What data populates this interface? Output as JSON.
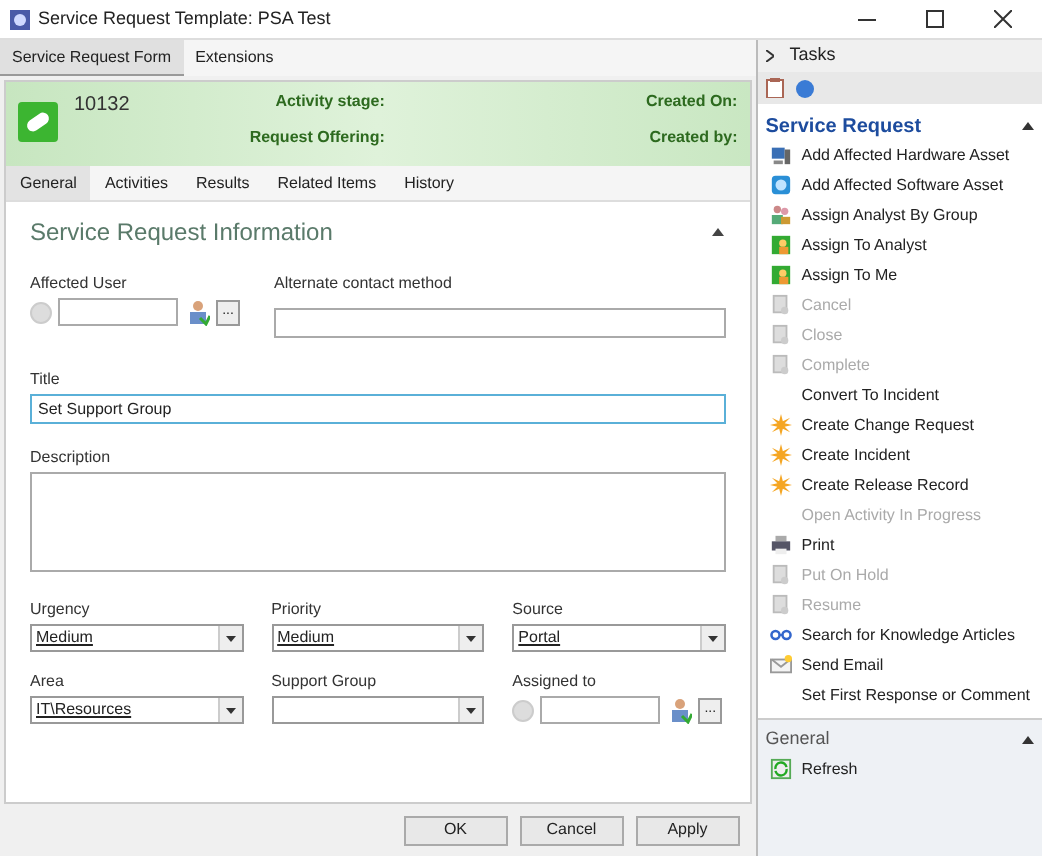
{
  "window": {
    "title": "Service Request Template: PSA Test"
  },
  "top_tabs": [
    {
      "label": "Service Request Form",
      "selected": true
    },
    {
      "label": "Extensions",
      "selected": false
    }
  ],
  "header": {
    "id": "10132",
    "activity_stage_label": "Activity stage:",
    "request_offering_label": "Request Offering:",
    "created_on_label": "Created On:",
    "created_by_label": "Created by:"
  },
  "sub_tabs": [
    {
      "label": "General",
      "selected": true
    },
    {
      "label": "Activities",
      "selected": false
    },
    {
      "label": "Results",
      "selected": false
    },
    {
      "label": "Related Items",
      "selected": false
    },
    {
      "label": "History",
      "selected": false
    }
  ],
  "section": {
    "title": "Service Request Information",
    "expanded": true
  },
  "fields": {
    "affected_user": {
      "label": "Affected User",
      "browse_label": "..."
    },
    "alternate_contact": {
      "label": "Alternate contact method"
    },
    "title": {
      "label": "Title",
      "value": "Set Support Group"
    },
    "description": {
      "label": "Description"
    },
    "urgency": {
      "label": "Urgency",
      "value": "Medium"
    },
    "priority": {
      "label": "Priority",
      "value": "Medium"
    },
    "source": {
      "label": "Source",
      "value": "Portal"
    },
    "area": {
      "label": "Area",
      "value": "IT\\Resources"
    },
    "support_group": {
      "label": "Support Group"
    },
    "assigned_to": {
      "label": "Assigned to",
      "browse_label": "..."
    }
  },
  "buttons": [
    "OK",
    "Cancel",
    "Apply"
  ],
  "tasks": {
    "title": "Tasks",
    "section": "Service Request",
    "items": [
      {
        "label": "Add Affected Hardware Asset",
        "kind": "hardware",
        "disabled": false
      },
      {
        "label": "Add Affected Software Asset",
        "kind": "software",
        "disabled": false
      },
      {
        "label": "Assign Analyst By Group",
        "kind": "group",
        "disabled": false
      },
      {
        "label": "Assign To Analyst",
        "kind": "assign",
        "disabled": false
      },
      {
        "label": "Assign To Me",
        "kind": "assign",
        "disabled": false
      },
      {
        "label": "Cancel",
        "kind": "doc",
        "disabled": true
      },
      {
        "label": "Close",
        "kind": "doc",
        "disabled": true
      },
      {
        "label": "Complete",
        "kind": "doc",
        "disabled": true
      },
      {
        "label": "Convert To Incident",
        "kind": "none",
        "disabled": false
      },
      {
        "label": "Create Change Request",
        "kind": "star",
        "disabled": false
      },
      {
        "label": "Create Incident",
        "kind": "star",
        "disabled": false
      },
      {
        "label": "Create Release Record",
        "kind": "star",
        "disabled": false
      },
      {
        "label": "Open Activity In Progress",
        "kind": "none",
        "disabled": true
      },
      {
        "label": "Print",
        "kind": "print",
        "disabled": false
      },
      {
        "label": "Put On Hold",
        "kind": "doc",
        "disabled": true
      },
      {
        "label": "Resume",
        "kind": "doc",
        "disabled": true
      },
      {
        "label": "Search for Knowledge Articles",
        "kind": "glasses",
        "disabled": false
      },
      {
        "label": "Send Email",
        "kind": "email",
        "disabled": false
      },
      {
        "label": "Set First Response or Comment",
        "kind": "none",
        "disabled": false
      }
    ],
    "general": {
      "title": "General",
      "items": [
        {
          "label": "Refresh",
          "kind": "refresh",
          "disabled": false
        }
      ]
    }
  }
}
